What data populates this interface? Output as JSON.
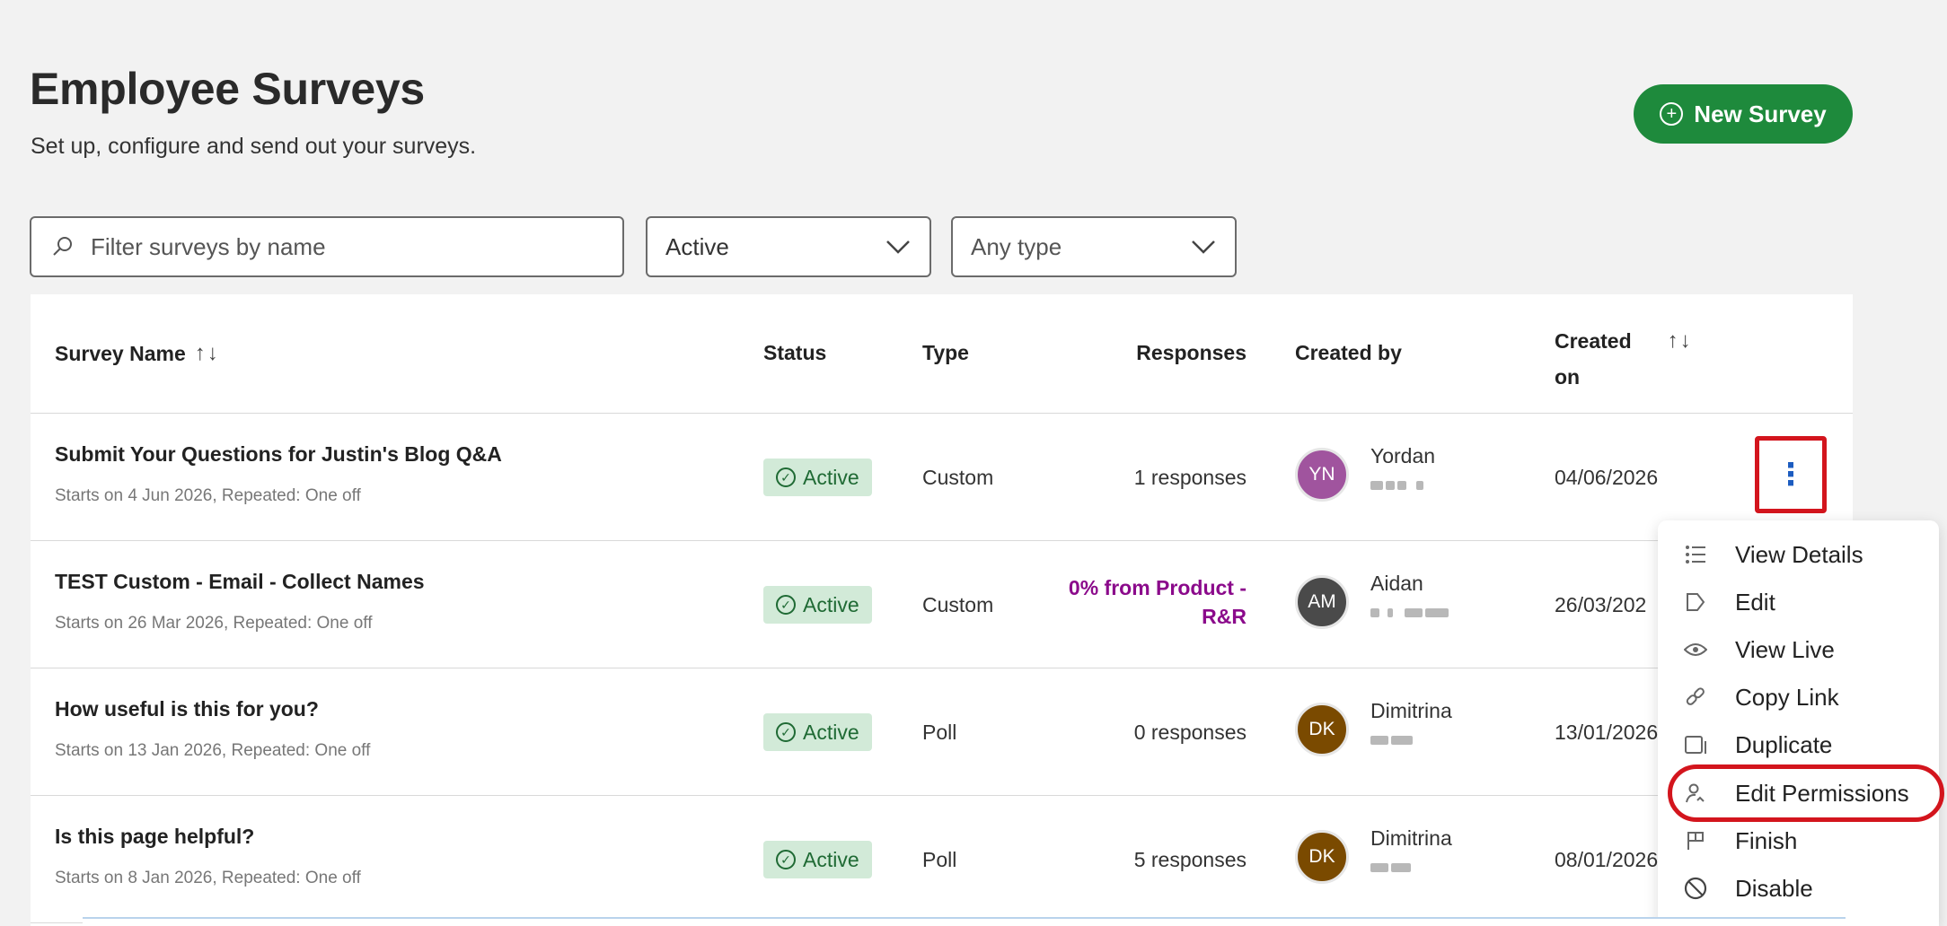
{
  "header": {
    "title": "Employee Surveys",
    "subtitle": "Set up, configure and send out your surveys.",
    "new_button": "New Survey"
  },
  "filters": {
    "search_placeholder": "Filter surveys by name",
    "status_value": "Active",
    "type_value": "Any type"
  },
  "table": {
    "columns": {
      "name": "Survey Name",
      "status": "Status",
      "type": "Type",
      "responses": "Responses",
      "created_by": "Created by",
      "created_on_line1": "Created",
      "created_on_line2": "on"
    },
    "sort_arrows": "↑↓",
    "rows": [
      {
        "name": "Submit Your Questions for Justin's Blog Q&A",
        "meta": "Starts on 4 Jun 2026, Repeated: One off",
        "status": "Active",
        "type": "Custom",
        "responses": "1 responses",
        "initials": "YN",
        "avatar_color": "#a0549e",
        "creator": "Yordan",
        "date": "04/06/2026"
      },
      {
        "name": "TEST Custom - Email - Collect Names",
        "meta": "Starts on 26 Mar 2026, Repeated: One off",
        "status": "Active",
        "type": "Custom",
        "responses_line1": "0% from Product -",
        "responses_line2": "R&R",
        "initials": "AM",
        "avatar_color": "#4a4a4a",
        "creator": "Aidan",
        "date": "26/03/202"
      },
      {
        "name": "How useful is this for you?",
        "meta": "Starts on 13 Jan 2026, Repeated: One off",
        "status": "Active",
        "type": "Poll",
        "responses": "0 responses",
        "initials": "DK",
        "avatar_color": "#7a4a00",
        "creator": "Dimitrina",
        "date": "13/01/2026"
      },
      {
        "name": "Is this page helpful?",
        "meta": "Starts on 8 Jan 2026, Repeated: One off",
        "status": "Active",
        "type": "Poll",
        "responses": "5 responses",
        "initials": "DK",
        "avatar_color": "#7a4a00",
        "creator": "Dimitrina",
        "date": "08/01/2026"
      }
    ]
  },
  "row_menu": {
    "kebab": "⋮",
    "items": [
      {
        "label": "View Details",
        "icon": "list-icon"
      },
      {
        "label": "Edit",
        "icon": "edit-icon"
      },
      {
        "label": "View Live",
        "icon": "eye-icon"
      },
      {
        "label": "Copy Link",
        "icon": "link-icon"
      },
      {
        "label": "Duplicate",
        "icon": "duplicate-icon"
      },
      {
        "label": "Edit Permissions",
        "icon": "person-icon"
      },
      {
        "label": "Finish",
        "icon": "flag-icon"
      },
      {
        "label": "Disable",
        "icon": "disable-icon"
      }
    ]
  },
  "colors": {
    "primary_green": "#1e8a3c",
    "active_badge_bg": "#d2ead8",
    "highlight_red": "#d3151d",
    "kebab_blue": "#1c5cc0",
    "responses_purple": "#8b0a8b"
  }
}
